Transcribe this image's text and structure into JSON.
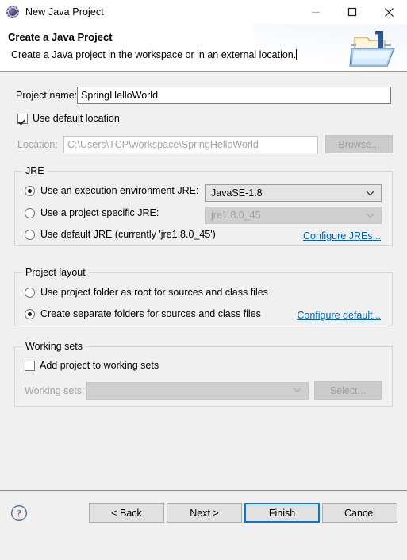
{
  "window": {
    "title": "New Java Project",
    "icon": "eclipse-gear-icon",
    "controls": {
      "minimize": "minimize-icon",
      "maximize": "maximize-icon",
      "close": "close-icon"
    }
  },
  "header": {
    "title": "Create a Java Project",
    "subtitle": "Create a Java project in the workspace or in an external location.",
    "banner_icon": "java-project-folder-icon"
  },
  "form": {
    "project_name_label": "Project name:",
    "project_name_value": "SpringHelloWorld",
    "project_name_placeholder": "",
    "use_default_location_label": "Use default location",
    "use_default_location_checked": true,
    "location_label": "Location:",
    "location_value": "C:\\Users\\TCP\\workspace\\SpringHelloWorld",
    "location_enabled": false,
    "browse_label": "Browse...",
    "browse_enabled": false
  },
  "jre": {
    "group_title": "JRE",
    "options": [
      {
        "label": "Use an execution environment JRE:",
        "selected": true,
        "combo_value": "JavaSE-1.8",
        "combo_enabled": true
      },
      {
        "label": "Use a project specific JRE:",
        "selected": false,
        "combo_value": "jre1.8.0_45",
        "combo_enabled": false
      },
      {
        "label": "Use default JRE (currently 'jre1.8.0_45')",
        "selected": false
      }
    ],
    "configure_link": "Configure JREs..."
  },
  "project_layout": {
    "group_title": "Project layout",
    "options": [
      {
        "label": "Use project folder as root for sources and class files",
        "selected": false
      },
      {
        "label": "Create separate folders for sources and class files",
        "selected": true
      }
    ],
    "configure_link": "Configure default..."
  },
  "working_sets": {
    "group_title": "Working sets",
    "add_label": "Add project to working sets",
    "add_checked": false,
    "sets_label": "Working sets:",
    "sets_value": "",
    "sets_enabled": false,
    "select_label": "Select...",
    "select_enabled": false
  },
  "footer": {
    "help_icon": "help-circle-icon",
    "back_label": "< Back",
    "next_label": "Next >",
    "finish_label": "Finish",
    "cancel_label": "Cancel",
    "finish_focused": true
  },
  "colors": {
    "accent_link": "#0062b1",
    "focus_border": "#0078d7",
    "body_bg": "#f0f0f0",
    "header_bg": "#ffffff",
    "group_border": "#d5d5d5"
  }
}
